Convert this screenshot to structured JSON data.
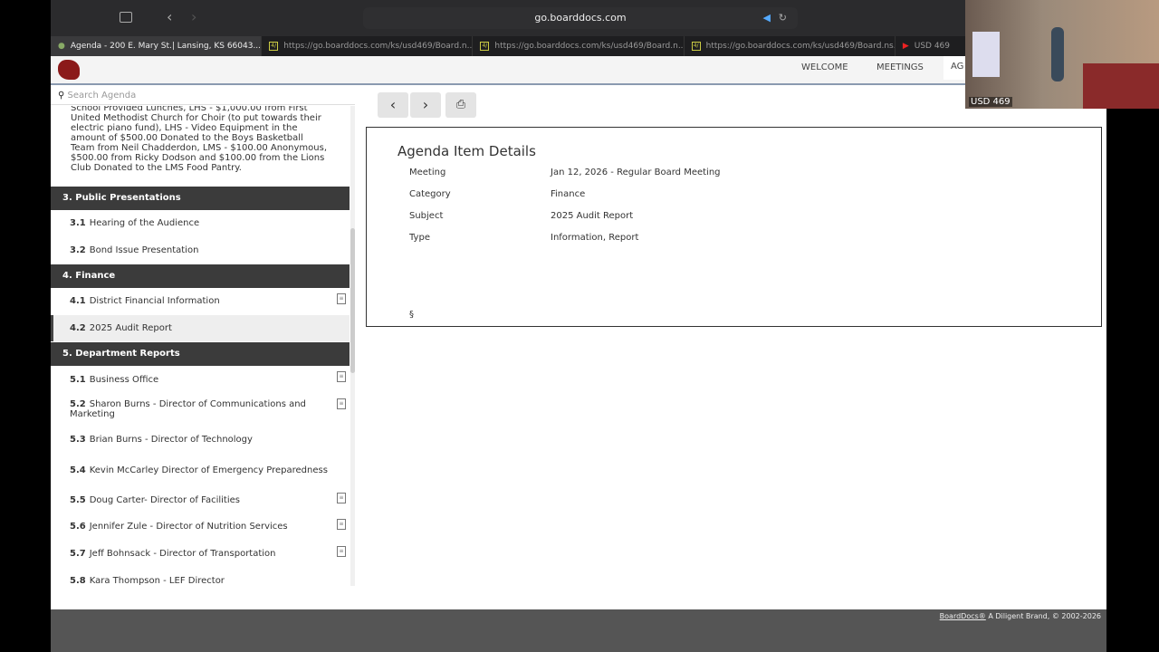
{
  "browser": {
    "url": "go.boarddocs.com",
    "tabs": [
      "Agenda - 200 E. Mary St.| Lansing, KS 66043...",
      "https://go.boarddocs.com/ks/usd469/Board.n...",
      "https://go.boarddocs.com/ks/usd469/Board.n...",
      "https://go.boarddocs.com/ks/usd469/Board.ns...",
      "USD 469"
    ]
  },
  "nav": [
    "WELCOME",
    "MEETINGS",
    "AG"
  ],
  "search": {
    "placeholder": "Search Agenda"
  },
  "sidebar": {
    "desc": "School Provided Lunches, LHS - $1,000.00 from First United Methodist Church for Choir (to put towards their electric piano fund), LHS - Video Equipment in the amount of $500.00 Donated to the Boys Basketball Team from Neil Chadderdon, LMS - $100.00 Anonymous, $500.00 from Ricky Dodson and $100.00 from the Lions Club Donated to the LMS Food Pantry.",
    "sections": [
      {
        "title": "3. Public Presentations",
        "items": [
          {
            "num": "3.1",
            "label": "Hearing of the Audience"
          },
          {
            "num": "3.2",
            "label": "Bond Issue Presentation"
          }
        ]
      },
      {
        "title": "4. Finance",
        "items": [
          {
            "num": "4.1",
            "label": "District Financial Information",
            "doc": true
          },
          {
            "num": "4.2",
            "label": "2025 Audit Report",
            "selected": true
          }
        ]
      },
      {
        "title": "5. Department Reports",
        "items": [
          {
            "num": "5.1",
            "label": "Business Office",
            "doc": true
          },
          {
            "num": "5.2",
            "label": "Sharon Burns - Director of Communications and Marketing",
            "doc": true
          },
          {
            "num": "5.3",
            "label": "Brian Burns - Director of Technology"
          },
          {
            "num": "5.4",
            "label": "Kevin McCarley Director of Emergency Preparedness"
          },
          {
            "num": "5.5",
            "label": "Doug Carter- Director of Facilities",
            "doc": true
          },
          {
            "num": "5.6",
            "label": "Jennifer Zule - Director of Nutrition Services",
            "doc": true
          },
          {
            "num": "5.7",
            "label": "Jeff Bohnsack - Director of Transportation",
            "doc": true
          },
          {
            "num": "5.8",
            "label": "Kara Thompson - LEF Director"
          }
        ]
      }
    ]
  },
  "details": {
    "title": "Agenda Item Details",
    "rows": [
      {
        "label": "Meeting",
        "value": "Jan 12, 2026 - Regular Board Meeting"
      },
      {
        "label": "Category",
        "value": "Finance"
      },
      {
        "label": "Subject",
        "value": "2025 Audit Report"
      },
      {
        "label": "Type",
        "value": "Information, Report"
      }
    ],
    "symbol": "§"
  },
  "footer": {
    "link": "BoardDocs®",
    "text": " A Diligent Brand, © 2002-2026"
  },
  "video": {
    "label": "USD 469"
  }
}
